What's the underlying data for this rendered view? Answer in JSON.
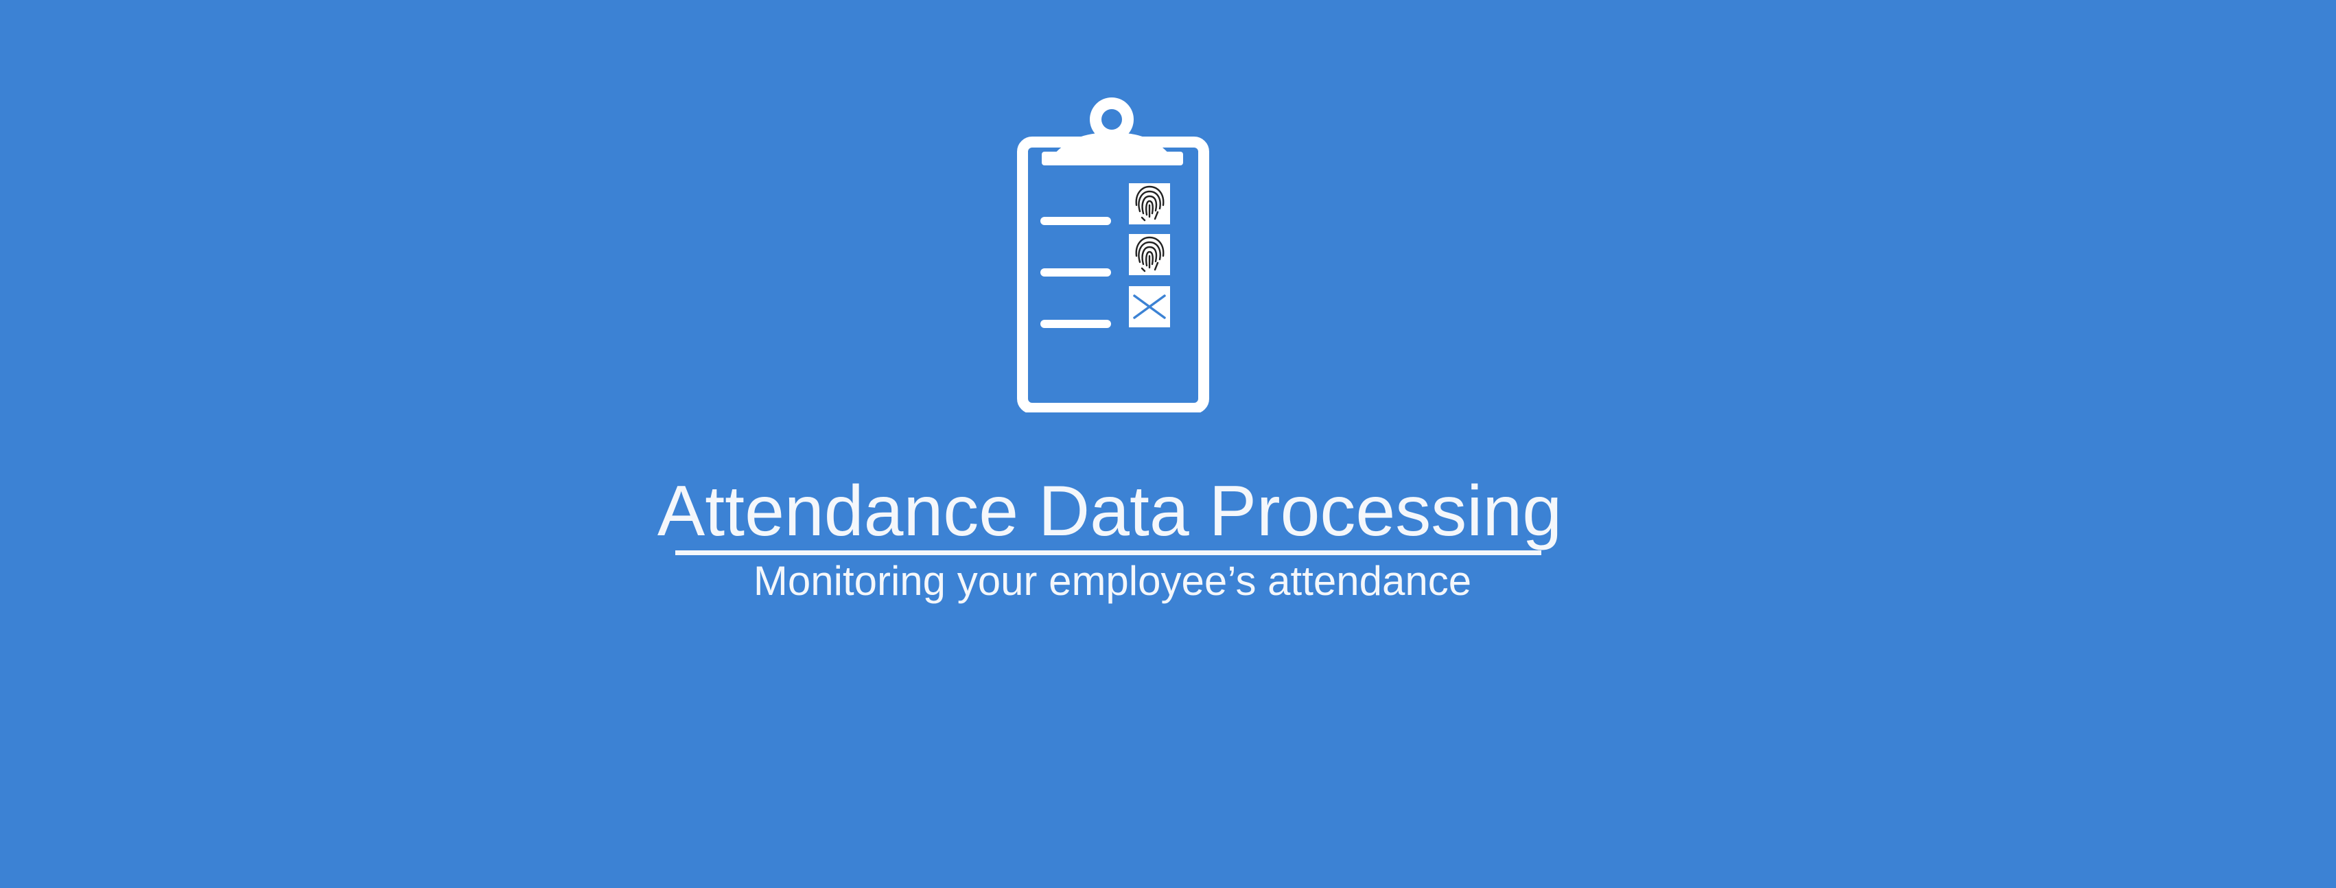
{
  "banner": {
    "background_color": "#3c82d4",
    "foreground_color": "#f4f7fb",
    "title": "Attendance Data Processing",
    "subtitle": "Monitoring your employee’s attendance",
    "icon": "clipboard-attendance-icon",
    "clipboard_rows": [
      {
        "mark": "fingerprint-icon"
      },
      {
        "mark": "fingerprint-icon"
      },
      {
        "mark": "cross-icon"
      }
    ]
  }
}
